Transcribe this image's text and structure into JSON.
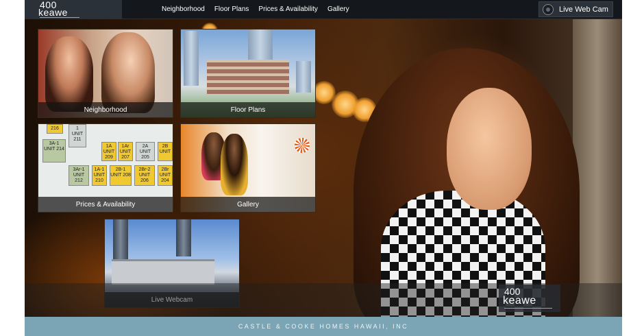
{
  "logo": {
    "number": "400",
    "word": "keawe"
  },
  "nav": {
    "items": [
      "Neighborhood",
      "Floor Plans",
      "Prices & Availability",
      "Gallery"
    ]
  },
  "webcam_button": {
    "label": "Live Web Cam"
  },
  "tiles": {
    "neighborhood": "Neighborhood",
    "floor_plans": "Floor Plans",
    "prices": "Prices & Availability",
    "gallery": "Gallery",
    "webcam": "Live Webcam"
  },
  "floorplan_units": [
    {
      "code": "216",
      "unit": ""
    },
    {
      "code": "1",
      "unit": "UNIT 211"
    },
    {
      "code": "3A-1",
      "unit": "UNIT 214"
    },
    {
      "code": "1A",
      "unit": "UNIT 209"
    },
    {
      "code": "1Ar",
      "unit": "UNIT 207"
    },
    {
      "code": "2A",
      "unit": "UNIT 205"
    },
    {
      "code": "2B",
      "unit": "UNIT"
    },
    {
      "code": "3Ar-1",
      "unit": "UNIT 212"
    },
    {
      "code": "1A-1",
      "unit": "UNIT 210"
    },
    {
      "code": "2B-1",
      "unit": "UNIT 208"
    },
    {
      "code": "2Br-2",
      "unit": "UNIT 206"
    },
    {
      "code": "2Br",
      "unit": "UNIT 204"
    }
  ],
  "bottom_logo": {
    "number": "400",
    "word": "keawe"
  },
  "footer": {
    "text": "CASTLE & COOKE HOMES HAWAII, INC"
  },
  "colors": {
    "footer_bg": "#7ba4b4",
    "topbar_bg": "#14181c",
    "accent": "#7ab0c8"
  }
}
